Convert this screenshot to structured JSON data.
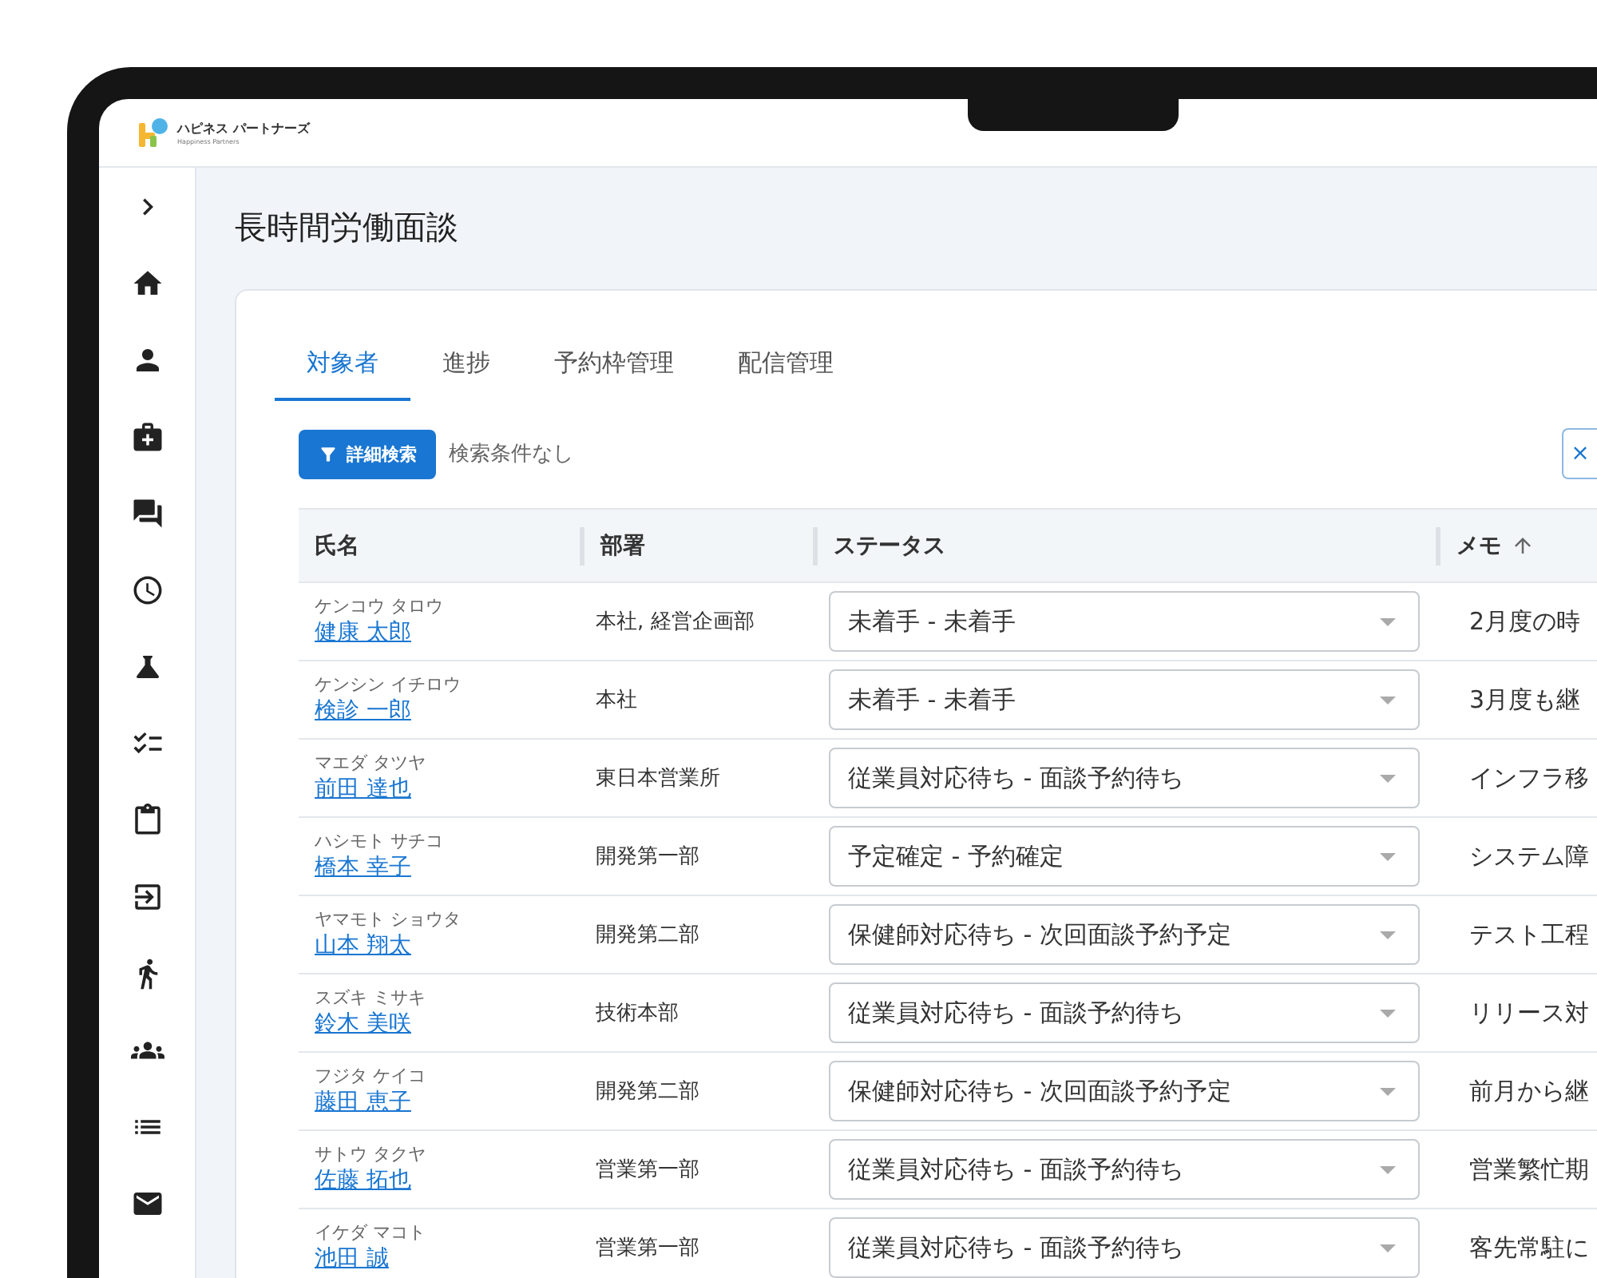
{
  "header": {
    "logo_text": "ハピネス パートナーズ",
    "logo_subtext": "Happiness Partners"
  },
  "page": {
    "title": "長時間労働面談"
  },
  "tabs": [
    {
      "label": "対象者",
      "selected": true
    },
    {
      "label": "進捗",
      "selected": false
    },
    {
      "label": "予約枠管理",
      "selected": false
    },
    {
      "label": "配信管理",
      "selected": false
    }
  ],
  "toolbar": {
    "filter_button": "詳細検索",
    "filter_status": "検索条件なし",
    "clear_button": "×"
  },
  "table": {
    "columns": [
      {
        "label": "氏名",
        "sorted": false
      },
      {
        "label": "部署",
        "sorted": false
      },
      {
        "label": "ステータス",
        "sorted": false
      },
      {
        "label": "メモ",
        "sorted": true
      }
    ],
    "rows": [
      {
        "kana": "ケンコウ タロウ",
        "name": "健康 太郎",
        "department": "本社, 経営企画部",
        "status": "未着手 - 未着手",
        "memo": "2月度の時"
      },
      {
        "kana": "ケンシン イチロウ",
        "name": "検診 一郎",
        "department": "本社",
        "status": "未着手 - 未着手",
        "memo": "3月度も継"
      },
      {
        "kana": "マエダ タツヤ",
        "name": "前田 達也",
        "department": "東日本営業所",
        "status": "従業員対応待ち - 面談予約待ち",
        "memo": "インフラ移"
      },
      {
        "kana": "ハシモト サチコ",
        "name": "橋本 幸子",
        "department": "開発第一部",
        "status": "予定確定 - 予約確定",
        "memo": "システム障"
      },
      {
        "kana": "ヤマモト ショウタ",
        "name": "山本 翔太",
        "department": "開発第二部",
        "status": "保健師対応待ち - 次回面談予約予定",
        "memo": "テスト工程"
      },
      {
        "kana": "スズキ ミサキ",
        "name": "鈴木 美咲",
        "department": "技術本部",
        "status": "従業員対応待ち - 面談予約待ち",
        "memo": "リリース対"
      },
      {
        "kana": "フジタ ケイコ",
        "name": "藤田 恵子",
        "department": "開発第二部",
        "status": "保健師対応待ち - 次回面談予約予定",
        "memo": "前月から継"
      },
      {
        "kana": "サトウ タクヤ",
        "name": "佐藤 拓也",
        "department": "営業第一部",
        "status": "従業員対応待ち - 面談予約待ち",
        "memo": "営業繁忙期"
      },
      {
        "kana": "イケダ マコト",
        "name": "池田 誠",
        "department": "営業第一部",
        "status": "従業員対応待ち - 面談予約待ち",
        "memo": "客先常駐に"
      }
    ]
  }
}
